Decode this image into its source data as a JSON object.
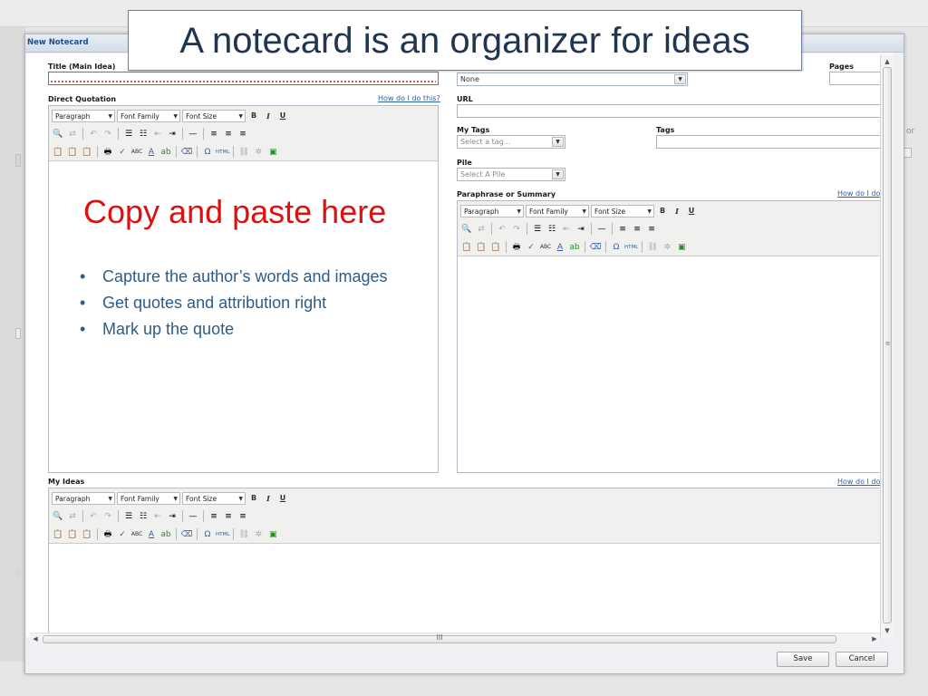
{
  "slide": {
    "title": "A notecard is an organizer for ideas",
    "heading": "Copy and paste here",
    "bullets": [
      "Capture the author’s words and images",
      "Get quotes and attribution right",
      "Mark up the quote"
    ]
  },
  "background": {
    "side_text": "or"
  },
  "dialog": {
    "title": "New Notecard",
    "fields": {
      "title_label": "Title (Main Idea)",
      "title_value": "",
      "source_select_value": "None",
      "pages_label": "Pages",
      "pages_value": "",
      "url_label": "URL",
      "url_value": "",
      "my_tags_label": "My Tags",
      "my_tags_placeholder": "Select a tag...",
      "tags_label": "Tags",
      "tags_value": "",
      "pile_label": "Pile",
      "pile_placeholder": "Select A Pile"
    },
    "editors": {
      "direct_quotation": {
        "label": "Direct Quotation",
        "help": "How do I do this?"
      },
      "paraphrase": {
        "label": "Paraphrase or Summary",
        "help": "How do I do"
      },
      "my_ideas": {
        "label": "My Ideas",
        "help": "How do I do"
      }
    },
    "toolbar": {
      "format": "Paragraph",
      "font_family": "Font Family",
      "font_size": "Font Size",
      "bold": "B",
      "italic": "I",
      "underline": "U",
      "abc": "ABC",
      "html": "HTML"
    },
    "buttons": {
      "save": "Save",
      "cancel": "Cancel"
    },
    "scroll_grip": "III",
    "vscroll_grip": "≡"
  },
  "colors": {
    "overlay_heading": "#e01010",
    "overlay_bullets": "#2d5c8a",
    "dialog_title": "#1f4e8c",
    "help_link": "#2c5fb3"
  }
}
